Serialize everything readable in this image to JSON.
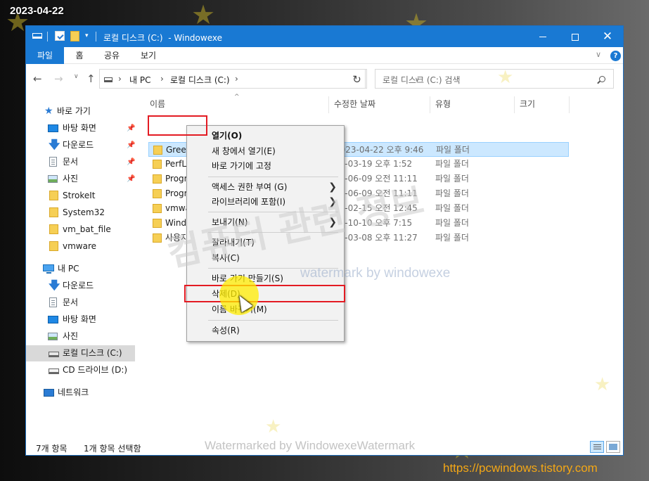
{
  "overlay": {
    "date": "2023-04-22",
    "url": "https://pcwindows.tistory.com",
    "watermark_big": "컴퓨터 관련 정보",
    "watermark_mid": "watermark by windowexe",
    "watermark_bottom": "Watermarked by WindowexeWatermark"
  },
  "window": {
    "title": "로컬 디스크 (C:)  - Windowexe",
    "controls": {
      "minimize": "—",
      "maximize": "☐",
      "close": "✕"
    }
  },
  "ribbon": {
    "tabs": [
      "파일",
      "홈",
      "공유",
      "보기"
    ],
    "help": "?"
  },
  "address": {
    "segments": [
      "내 PC",
      "로컬 디스크 (C:)"
    ],
    "search_placeholder": "로컬 디스크 (C:) 검색"
  },
  "nav": {
    "quick_access": "바로 가기",
    "quick_items": [
      {
        "label": "바탕 화면",
        "icon": "desktop-icon",
        "pinned": true
      },
      {
        "label": "다운로드",
        "icon": "download-icon",
        "pinned": true
      },
      {
        "label": "문서",
        "icon": "document-icon",
        "pinned": true
      },
      {
        "label": "사진",
        "icon": "pictures-icon",
        "pinned": true
      },
      {
        "label": "StrokeIt",
        "icon": "folder-icon",
        "pinned": false
      },
      {
        "label": "System32",
        "icon": "folder-icon",
        "pinned": false
      },
      {
        "label": "vm_bat_file",
        "icon": "folder-icon",
        "pinned": false
      },
      {
        "label": "vmware",
        "icon": "folder-icon",
        "pinned": false
      }
    ],
    "this_pc": "내 PC",
    "pc_items": [
      {
        "label": "다운로드",
        "icon": "download-icon"
      },
      {
        "label": "문서",
        "icon": "document-icon"
      },
      {
        "label": "바탕 화면",
        "icon": "desktop-icon"
      },
      {
        "label": "사진",
        "icon": "pictures-icon"
      },
      {
        "label": "로컬 디스크 (C:)",
        "icon": "drive-icon",
        "selected": true
      },
      {
        "label": "CD 드라이브 (D:)",
        "icon": "cd-drive-icon"
      }
    ],
    "network": "네트워크"
  },
  "columns": [
    "이름",
    "수정한 날짜",
    "유형",
    "크기"
  ],
  "files": [
    {
      "name": "GreenT",
      "date": "2023-04-22 오후 9:46",
      "type": "파일 폴더",
      "selected": true
    },
    {
      "name": "PerfLo",
      "date": "19-03-19 오후 1:52",
      "type": "파일 폴더"
    },
    {
      "name": "Progr",
      "date": "22-06-09 오전 11:11",
      "type": "파일 폴더"
    },
    {
      "name": "Progr",
      "date": "22-06-09 오전 11:11",
      "type": "파일 폴더"
    },
    {
      "name": "vmwa",
      "date": "22-02-15 오전 12:45",
      "type": "파일 폴더"
    },
    {
      "name": "Windo",
      "date": "22-10-10 오후 7:15",
      "type": "파일 폴더"
    },
    {
      "name": "사용자",
      "date": "20-03-08 오후 11:27",
      "type": "파일 폴더"
    }
  ],
  "context_menu": {
    "items": [
      {
        "label": "열기(O)",
        "bold": true
      },
      {
        "label": "새 창에서 열기(E)"
      },
      {
        "label": "바로 가기에 고정"
      },
      {
        "label": "액세스 권한 부여 (G)",
        "submenu": true
      },
      {
        "label": "라이브러리에 포함(I)",
        "submenu": true
      },
      {
        "label": "보내기(N)",
        "submenu": true
      },
      {
        "label": "잘라내기(T)"
      },
      {
        "label": "복사(C)"
      },
      {
        "label": "바로 가기 만들기(S)"
      },
      {
        "label": "삭제(D)"
      },
      {
        "label": "이름 바꾸기(M)"
      },
      {
        "label": "속성(R)"
      }
    ],
    "submenu_glyph": "❯"
  },
  "status": {
    "count": "7개 항목",
    "selected": "1개 항목 선택함"
  },
  "colors": {
    "accent": "#1979d3",
    "selection": "#cce8ff",
    "highlight_border": "#e31b23",
    "url": "#f3a716"
  }
}
